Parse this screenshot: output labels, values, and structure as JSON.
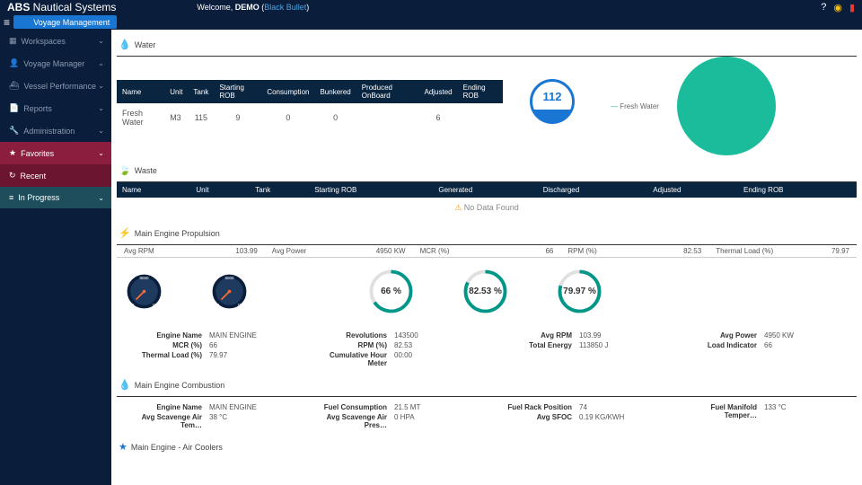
{
  "header": {
    "brand_prefix": "ABS",
    "brand_rest": " Nautical Systems",
    "welcome_prefix": "Welcome, ",
    "welcome_user": "DEMO",
    "welcome_open": " (",
    "welcome_vessel": "Black Bullet",
    "welcome_close": ")",
    "voyage_btn": "Voyage Management"
  },
  "sidebar": {
    "items": [
      "Workspaces",
      "Voyage Manager",
      "Vessel Performance",
      "Reports",
      "Administration",
      "Favorites",
      "Recent",
      "In Progress"
    ]
  },
  "water": {
    "title": "Water",
    "cols": [
      "Name",
      "Unit",
      "Tank",
      "Starting ROB",
      "Consumption",
      "Bunkered",
      "Produced OnBoard",
      "Adjusted",
      "Ending ROB"
    ],
    "row": {
      "name": "Fresh Water",
      "unit": "M3",
      "tank": "115",
      "start": "9",
      "consumption": "0",
      "bunkered": "0",
      "produced": "",
      "adjusted": "6",
      "ending": ""
    },
    "gauge_value": "112",
    "pie_label": "Fresh Water"
  },
  "waste": {
    "title": "Waste",
    "cols": [
      "Name",
      "Unit",
      "Tank",
      "Starting ROB",
      "Generated",
      "Discharged",
      "Adjusted",
      "Ending ROB"
    ],
    "no_data": "No Data Found"
  },
  "propulsion": {
    "title": "Main Engine Propulsion",
    "metrics": {
      "avg_rpm": {
        "label": "Avg RPM",
        "value": "103.99"
      },
      "avg_power": {
        "label": "Avg Power",
        "value": "4950 KW"
      },
      "mcr": {
        "label": "MCR (%)",
        "value": "66"
      },
      "rpm_pct": {
        "label": "RPM (%)",
        "value": "82.53"
      },
      "thermal": {
        "label": "Thermal Load (%)",
        "value": "79.97"
      }
    },
    "pct_gauges": {
      "a": "66 %",
      "b": "82.53 %",
      "c": "79.97 %"
    },
    "details": {
      "c1": [
        [
          "Engine Name",
          "MAIN ENGINE"
        ],
        [
          "MCR (%)",
          "66"
        ],
        [
          "Thermal Load (%)",
          "79.97"
        ]
      ],
      "c2": [
        [
          "Revolutions",
          "143500"
        ],
        [
          "RPM (%)",
          "82.53"
        ],
        [
          "Cumulative Hour Meter",
          "00:00"
        ]
      ],
      "c3": [
        [
          "Avg RPM",
          "103.99"
        ],
        [
          "Total Energy",
          "113850 J"
        ]
      ],
      "c4": [
        [
          "Avg Power",
          "4950 KW"
        ],
        [
          "Load Indicator",
          "66"
        ]
      ]
    }
  },
  "combustion": {
    "title": "Main Engine Combustion",
    "details": {
      "c1": [
        [
          "Engine Name",
          "MAIN ENGINE"
        ],
        [
          "Avg Scavenge Air Tem…",
          "38 °C"
        ]
      ],
      "c2": [
        [
          "Fuel Consumption",
          "21.5 MT"
        ],
        [
          "Avg Scavenge Air Pres…",
          "0 HPA"
        ]
      ],
      "c3": [
        [
          "Fuel Rack Position",
          "74"
        ],
        [
          "Avg SFOC",
          "0.19 KG/KWH"
        ]
      ],
      "c4": [
        [
          "Fuel Manifold Temper…",
          "133 °C"
        ]
      ]
    }
  },
  "aircoolers": {
    "title": "Main Engine - Air Coolers"
  }
}
